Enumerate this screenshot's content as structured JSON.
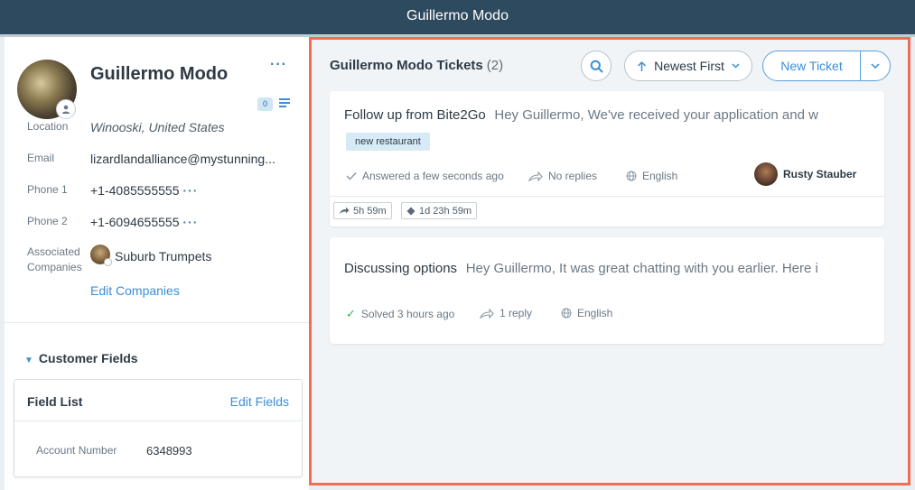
{
  "window": {
    "title": "Guillermo Modo"
  },
  "profile": {
    "name": "Guillermo Modo",
    "badge_count": "0",
    "location_label": "Location",
    "location": "Winooski, United States",
    "email_label": "Email",
    "email": "lizardlandalliance@mystunning...",
    "phone1_label": "Phone 1",
    "phone1": "+1-4085555555",
    "phone2_label": "Phone 2",
    "phone2": "+1-6094655555",
    "companies_label_1": "Associated",
    "companies_label_2": "Companies",
    "company": "Suburb Trumpets",
    "edit_companies": "Edit Companies"
  },
  "customer_fields": {
    "title": "Customer Fields",
    "field_list_title": "Field List",
    "edit_fields": "Edit Fields",
    "account_number_label": "Account Number",
    "account_number": "6348993"
  },
  "tickets": {
    "title": "Guillermo Modo Tickets",
    "count": "(2)",
    "sort_label": "Newest First",
    "new_ticket_label": "New Ticket",
    "items": [
      {
        "subject": "Follow up from Bite2Go",
        "preview": "Hey Guillermo,  We've received your application and w",
        "tag": "new restaurant",
        "status": "Answered a few seconds ago",
        "replies": "No replies",
        "language": "English",
        "agent": "Rusty Stauber",
        "sla_first": "5h 59m",
        "sla_second": "1d 23h 59m"
      },
      {
        "subject": "Discussing options",
        "preview": "Hey Guillermo, It was great chatting with you earlier. Here i",
        "status": "Solved 3 hours ago",
        "replies": "1 reply",
        "language": "English"
      }
    ]
  },
  "icons": {
    "search": "search-icon",
    "sort": "arrow-up-icon",
    "caret": "chevron-down-icon",
    "check": "checkmark-icon",
    "reply": "reply-arrow-icon",
    "globe": "globe-icon"
  },
  "colors": {
    "topbar": "#2e4a5f",
    "accent": "#3b8ed8",
    "highlight_border": "#ef6e55",
    "success": "#3bb54a",
    "tag_bg": "#d6ebf7"
  }
}
